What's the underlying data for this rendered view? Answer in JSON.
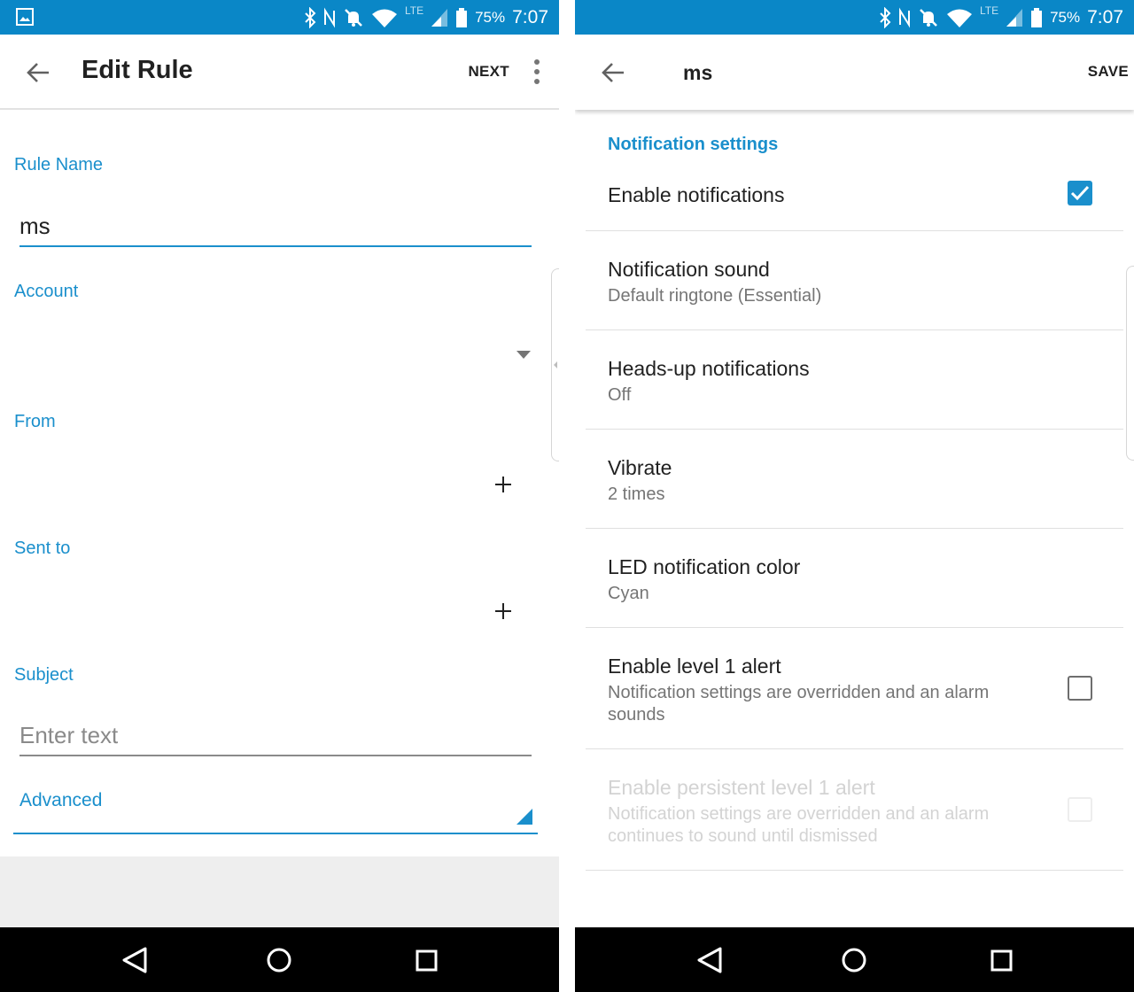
{
  "colors": {
    "accent": "#1a8fcc",
    "status_bar": "#0a87c7",
    "nav_bar": "#000000"
  },
  "status_bar": {
    "battery": "75%",
    "time": "7:07",
    "network": "LTE"
  },
  "left": {
    "app_bar": {
      "title": "Edit Rule",
      "action": "NEXT"
    },
    "form": {
      "rule_name_label": "Rule Name",
      "rule_name_value": "ms",
      "account_label": "Account",
      "from_label": "From",
      "sent_to_label": "Sent to",
      "subject_label": "Subject",
      "subject_placeholder": "Enter text",
      "advanced_label": "Advanced"
    }
  },
  "right": {
    "app_bar": {
      "title": "ms",
      "action": "SAVE"
    },
    "section_header": "Notification settings",
    "prefs": [
      {
        "title": "Enable notifications",
        "summary": "",
        "checkbox": "checked"
      },
      {
        "title": "Notification sound",
        "summary": "Default ringtone (Essential)"
      },
      {
        "title": "Heads-up notifications",
        "summary": "Off"
      },
      {
        "title": "Vibrate",
        "summary": "2 times"
      },
      {
        "title": "LED notification color",
        "summary": "Cyan"
      },
      {
        "title": "Enable level 1 alert",
        "summary": "Notification settings are overridden and an alarm sounds",
        "checkbox": "unchecked"
      },
      {
        "title": "Enable persistent level 1 alert",
        "summary": "Notification settings are overridden and an alarm continues to sound until dismissed",
        "checkbox": "unchecked",
        "disabled": true
      }
    ]
  },
  "icons": {
    "status_left": "image-icon",
    "status_right": [
      "bluetooth-icon",
      "nfc-icon",
      "notifications-off-icon",
      "wifi-icon",
      "signal-icon",
      "battery-icon"
    ],
    "nav": [
      "back-triangle-icon",
      "home-circle-icon",
      "recents-square-icon"
    ]
  }
}
